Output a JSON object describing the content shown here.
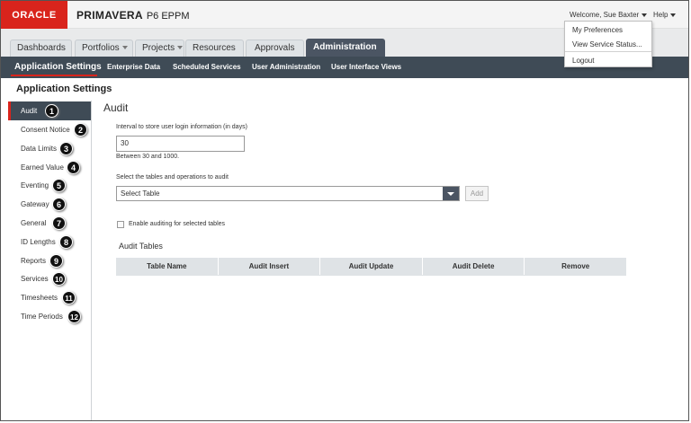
{
  "header": {
    "logo": "ORACLE",
    "product": "PRIMAVERA",
    "edition": "P6 EPPM",
    "welcome": "Welcome, Sue Baxter",
    "help": "Help"
  },
  "user_menu": {
    "items": [
      "My Preferences",
      "View Service Status...",
      "Logout"
    ]
  },
  "tabs": [
    {
      "label": "Dashboards",
      "dropdown": true
    },
    {
      "label": "Portfolios",
      "dropdown": true
    },
    {
      "label": "Projects",
      "dropdown": true
    },
    {
      "label": "Resources",
      "dropdown": false
    },
    {
      "label": "Approvals",
      "dropdown": false
    },
    {
      "label": "Administration",
      "dropdown": false,
      "active": true
    }
  ],
  "subnav": [
    "Application Settings",
    "Enterprise Data",
    "Scheduled Services",
    "User Administration",
    "User Interface Views"
  ],
  "page_title": "Application Settings",
  "sidebar": {
    "items": [
      {
        "label": "Audit",
        "badge": "1",
        "active": true
      },
      {
        "label": "Consent Notice",
        "badge": "2"
      },
      {
        "label": "Data Limits",
        "badge": "3"
      },
      {
        "label": "Earned Value",
        "badge": "4"
      },
      {
        "label": "Eventing",
        "badge": "5"
      },
      {
        "label": "Gateway",
        "badge": "6"
      },
      {
        "label": "General",
        "badge": "7"
      },
      {
        "label": "ID Lengths",
        "badge": "8"
      },
      {
        "label": "Reports",
        "badge": "9"
      },
      {
        "label": "Services",
        "badge": "10"
      },
      {
        "label": "Timesheets",
        "badge": "11"
      },
      {
        "label": "Time Periods",
        "badge": "12"
      }
    ]
  },
  "audit": {
    "title": "Audit",
    "interval_label": "Interval to store user login information (in days)",
    "interval_value": "30",
    "interval_hint": "Between 30 and 1000.",
    "tables_label": "Select the tables and operations to audit",
    "select_value": "Select Table",
    "add_label": "Add",
    "enable_label": "Enable auditing for selected tables",
    "table_title": "Audit Tables",
    "columns": [
      "Table Name",
      "Audit Insert",
      "Audit Update",
      "Audit Delete",
      "Remove"
    ]
  },
  "colors": {
    "brand_red": "#d9241c",
    "nav_dark": "#3f4b56",
    "active_tab": "#4b5563"
  }
}
